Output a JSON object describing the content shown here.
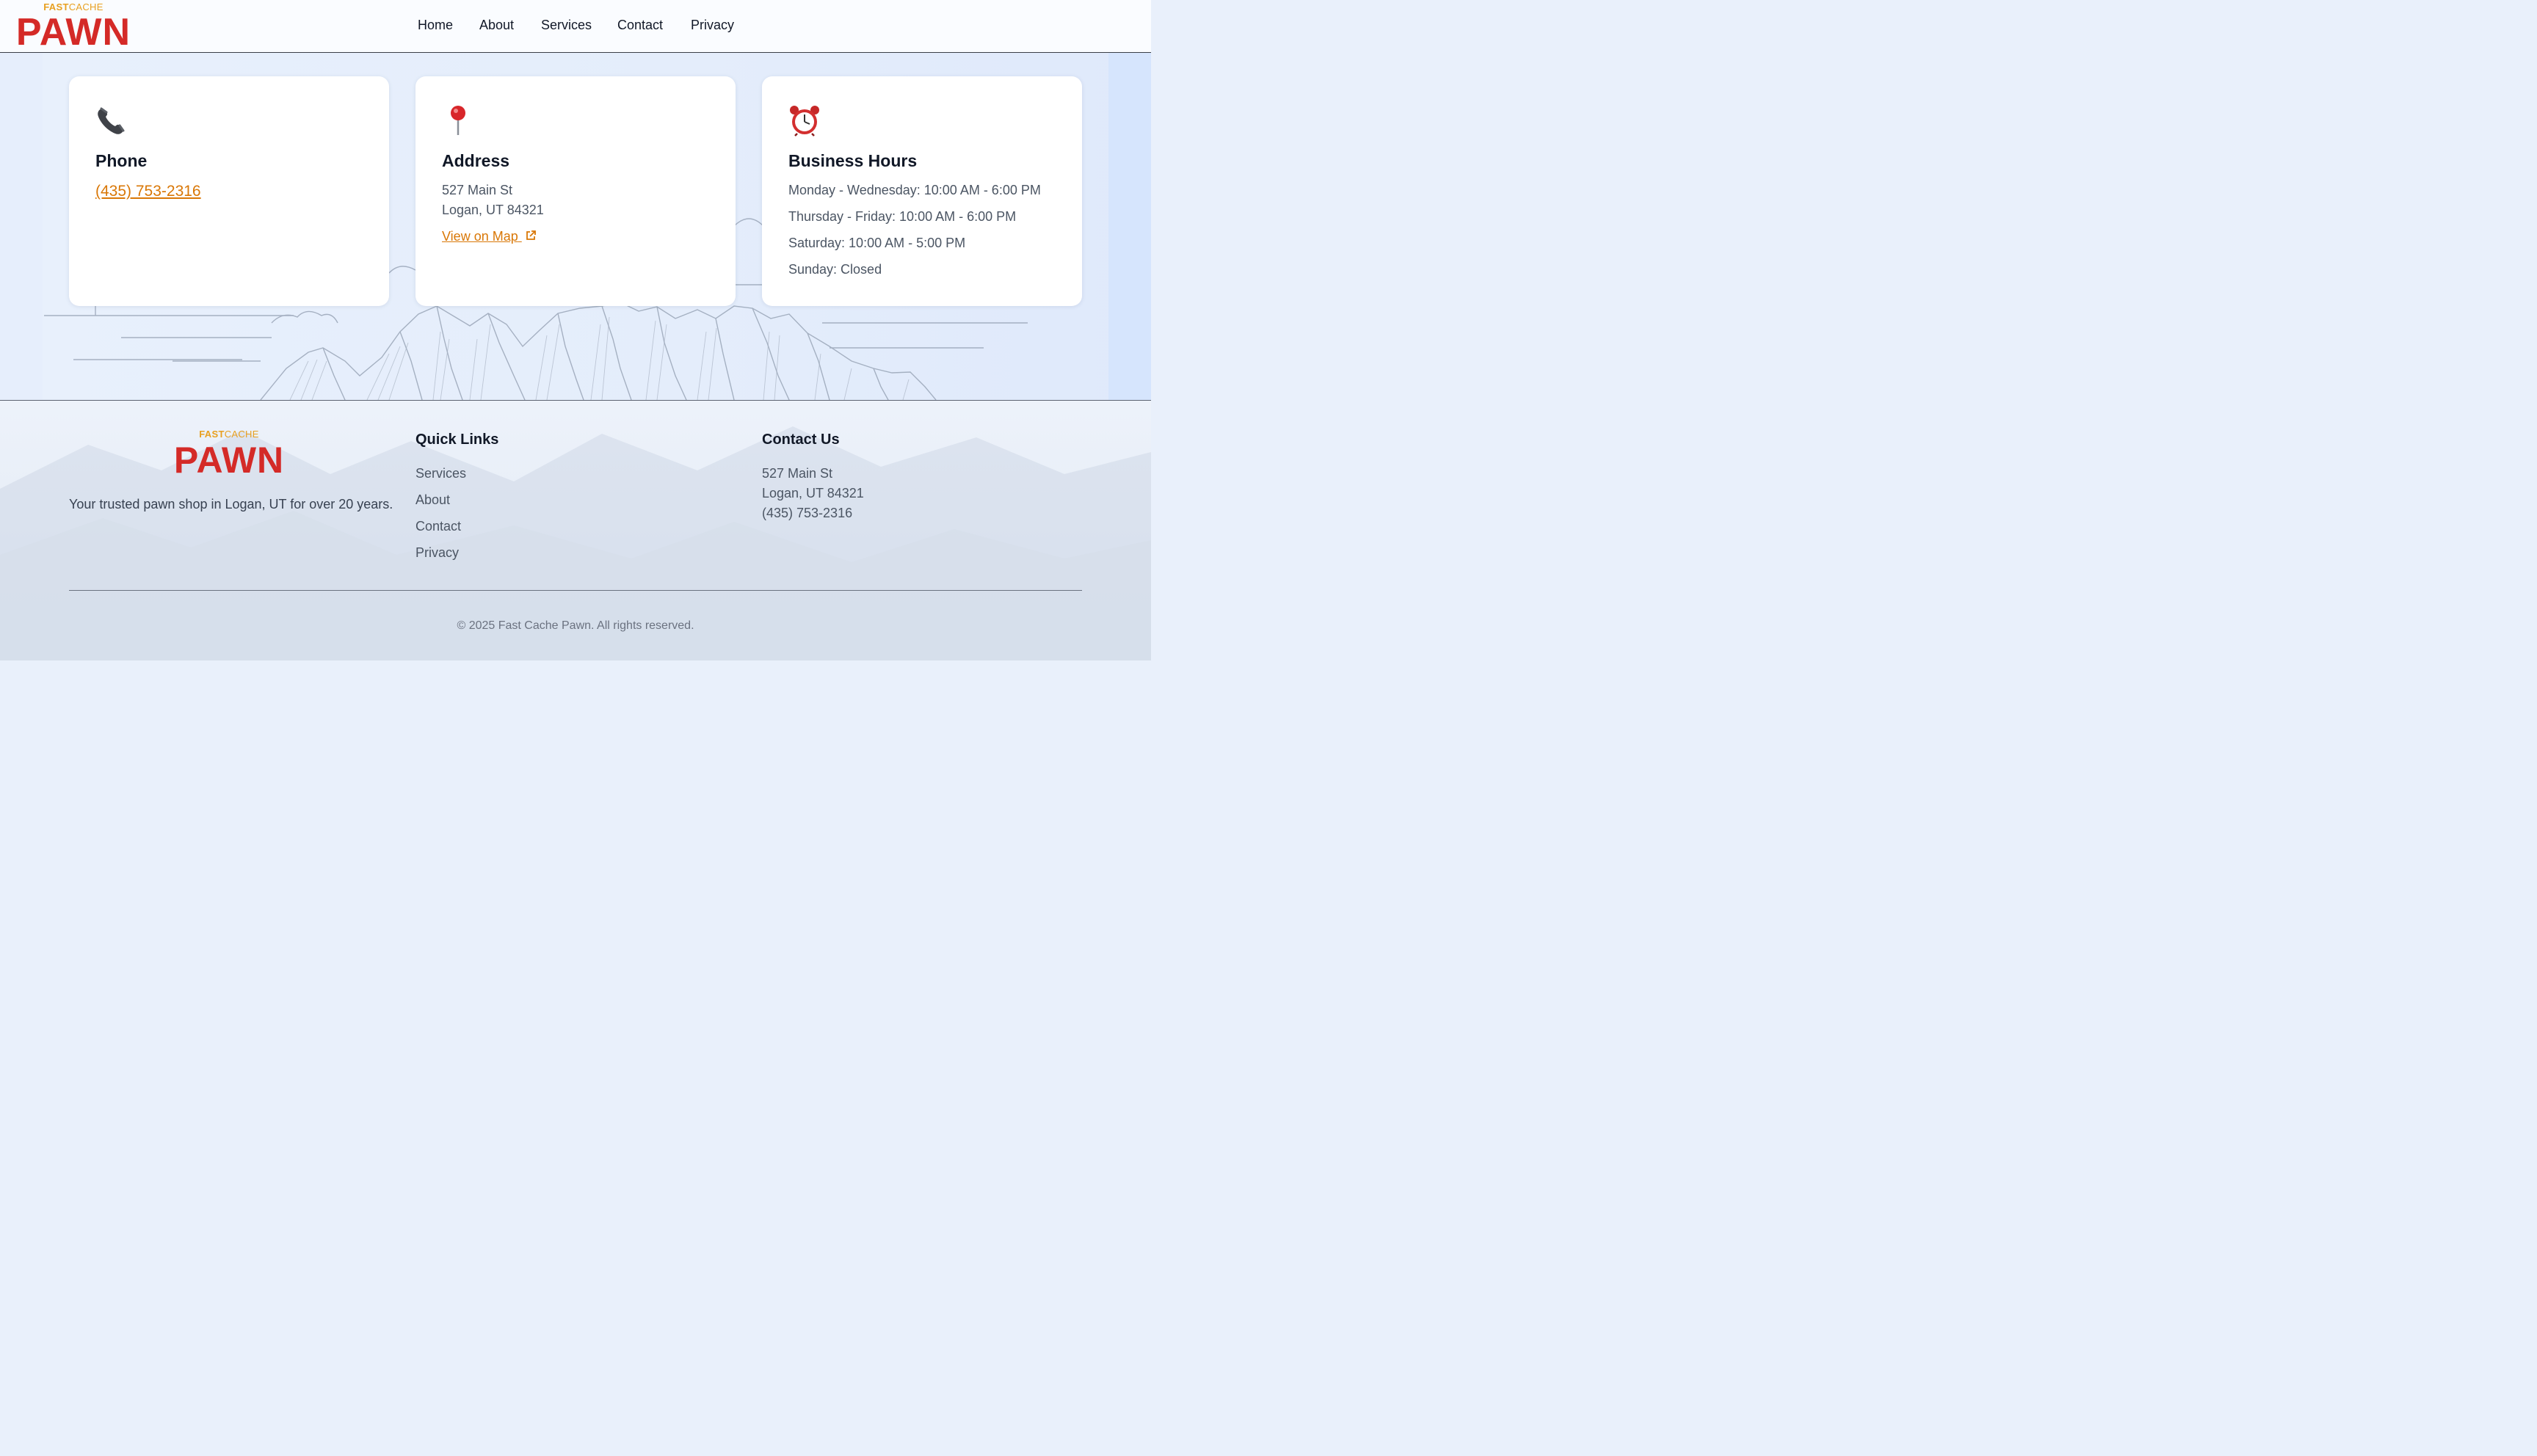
{
  "brand": {
    "sub_fast": "FAST",
    "sub_cache": "CACHE",
    "name": "PAWN",
    "primary_color": "#d42a27",
    "accent_color": "#e8a020"
  },
  "nav": {
    "items": [
      {
        "label": "Home"
      },
      {
        "label": "About"
      },
      {
        "label": "Services"
      },
      {
        "label": "Contact"
      },
      {
        "label": "Privacy"
      }
    ]
  },
  "cards": {
    "phone": {
      "icon": "telephone-icon",
      "title": "Phone",
      "number": "(435) 753-2316"
    },
    "address": {
      "icon": "map-pin-icon",
      "title": "Address",
      "line1": "527 Main St",
      "line2": "Logan, UT 84321",
      "map_link": "View on Map",
      "map_link_icon": "external-link-icon"
    },
    "hours": {
      "icon": "alarm-clock-icon",
      "title": "Business Hours",
      "lines": [
        "Monday - Wednesday: 10:00 AM - 6:00 PM",
        "Thursday - Friday: 10:00 AM - 6:00 PM",
        "Saturday: 10:00 AM - 5:00 PM",
        "Sunday: Closed"
      ]
    }
  },
  "footer": {
    "tagline": "Your trusted pawn shop in Logan, UT for over 20 years.",
    "quick_links": {
      "title": "Quick Links",
      "items": [
        {
          "label": "Services"
        },
        {
          "label": "About"
        },
        {
          "label": "Contact"
        },
        {
          "label": "Privacy"
        }
      ]
    },
    "contact": {
      "title": "Contact Us",
      "line1": "527 Main St",
      "line2": "Logan, UT 84321",
      "phone": "(435) 753-2316"
    },
    "copyright": "© 2025 Fast Cache Pawn. All rights reserved."
  }
}
